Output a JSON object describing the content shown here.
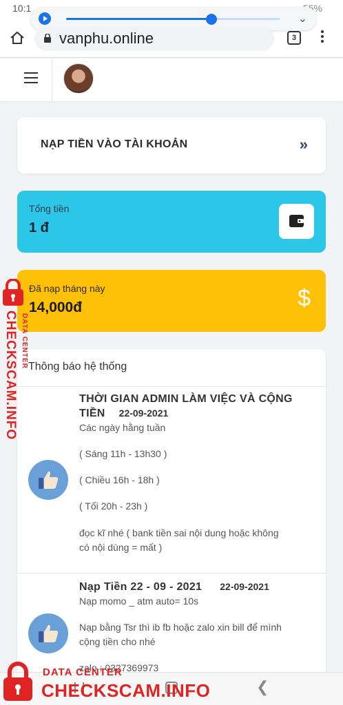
{
  "status_bar": {
    "time": "10:1",
    "battery": "55%"
  },
  "media": {
    "progress": 0.68
  },
  "browser": {
    "url": "vanphu.online",
    "tab_count": "3"
  },
  "deposit": {
    "title": "NẠP TIỀN VÀO TÀI KHOẢN",
    "arrow": "»"
  },
  "balance": {
    "label": "Tổng tiền",
    "value": "1 đ"
  },
  "monthly": {
    "label": "Đã nạp tháng này",
    "value": "14,000đ",
    "icon": "$"
  },
  "notices": {
    "title": "Thông báo hệ thống",
    "posts": [
      {
        "title_line1": "THỜI GIAN ADMIN LÀM VIỆC VÀ CỘNG",
        "title_line2": "TIỀN",
        "date": "22-09-2021",
        "lines": [
          "Các ngày hằng tuần",
          "( Sáng 11h - 13h30 )",
          "( Chiều 16h - 18h )",
          "( Tối 20h - 23h )",
          "đọc kĩ nhé  ( bank tiền sai nội dung hoặc không",
          "có nội dùng = mất )"
        ]
      },
      {
        "title_line1": "Nạp Tiền 22 - 09 - 2021",
        "date": "22-09-2021",
        "lines": [
          "Nạp momo _ atm auto= 10s",
          "Nạp bằng Tsr thì ib fb hoặc zalo xin bill để mình",
          "cộng tiền cho nhé",
          "zalo : 0327369973"
        ]
      }
    ]
  },
  "watermark": {
    "brand": "CHECKSCAM.INFO",
    "tagline": "DATA CENTER"
  },
  "icons": {
    "home": "home-icon",
    "lock": "lock-icon",
    "wallet": "wallet-icon",
    "dollar": "dollar-icon",
    "like": "thumbs-up-icon"
  },
  "colors": {
    "balance_card": "#2cc6e8",
    "monthly_card": "#ffc107",
    "accent": "#1a73e8",
    "watermark": "#e02424"
  }
}
